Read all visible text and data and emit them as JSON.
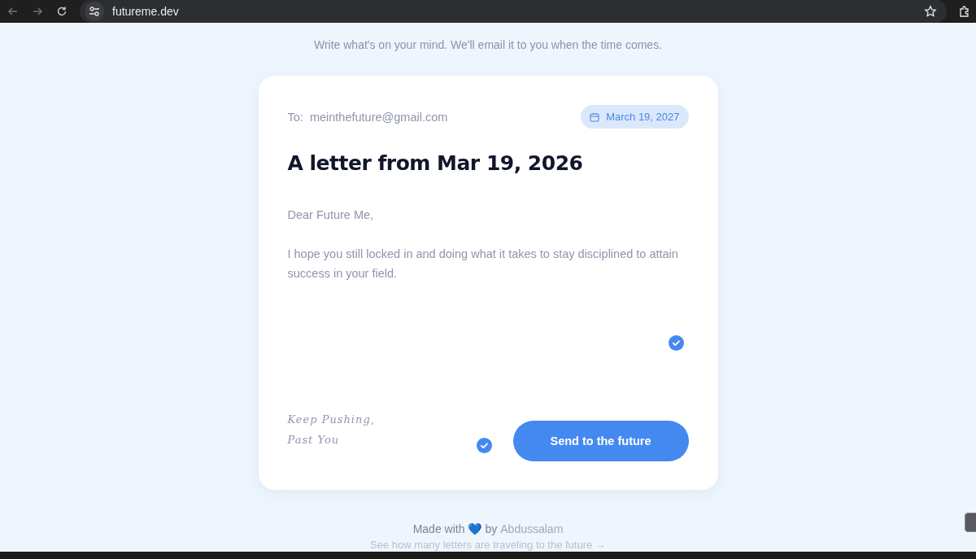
{
  "browser": {
    "url": "futureme.dev"
  },
  "subtitle": "Write what's on your mind. We'll email it to you when the time comes.",
  "letter": {
    "to_label": "To:",
    "to_value": "meinthefuture@gmail.com",
    "delivery_date": "March 19, 2027",
    "title": "A letter from Mar 19, 2026",
    "body": "Dear Future Me,\n\nI hope you still locked in and doing what it takes to stay disciplined to attain success in your field.",
    "signature": [
      "Keep Pushing,",
      "Past You"
    ],
    "send_button": "Send to the future"
  },
  "footer": {
    "made_with": "Made with",
    "heart": "💙",
    "by": "by",
    "author": "Abdussalam",
    "stats_link": "See how many letters are traveling to the future →"
  }
}
